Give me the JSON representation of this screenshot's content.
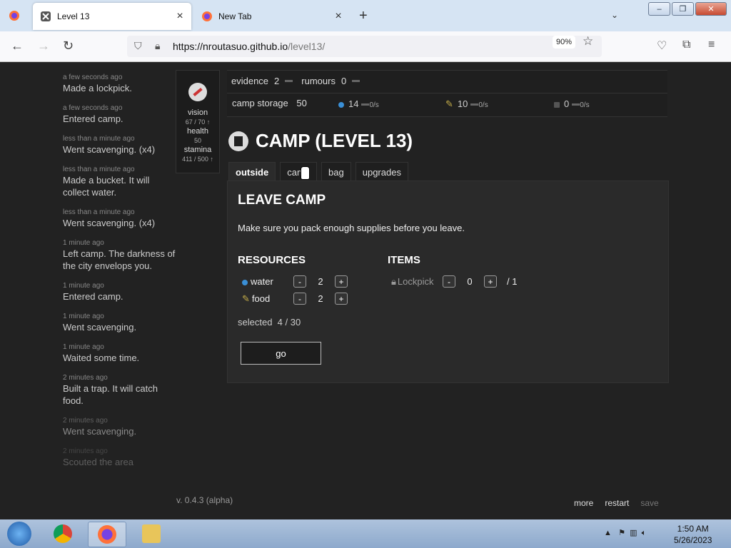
{
  "browser": {
    "tabs": [
      {
        "title": "Level 13",
        "active": true
      },
      {
        "title": "New Tab",
        "active": false
      }
    ],
    "url_host": "https://nroutasuo.github.io",
    "url_path": "/level13/",
    "zoom": "90%"
  },
  "log": [
    {
      "time": "a few seconds ago",
      "msg": "Made a lockpick."
    },
    {
      "time": "a few seconds ago",
      "msg": "Entered camp."
    },
    {
      "time": "less than a minute ago",
      "msg": "Went scavenging. (x4)"
    },
    {
      "time": "less than a minute ago",
      "msg": "Made a bucket. It will collect water."
    },
    {
      "time": "less than a minute ago",
      "msg": "Went scavenging. (x4)"
    },
    {
      "time": "1 minute ago",
      "msg": "Left camp. The darkness of the city envelops you."
    },
    {
      "time": "1 minute ago",
      "msg": "Entered camp."
    },
    {
      "time": "1 minute ago",
      "msg": "Went scavenging."
    },
    {
      "time": "1 minute ago",
      "msg": "Waited some time."
    },
    {
      "time": "2 minutes ago",
      "msg": "Built a trap. It will catch food."
    },
    {
      "time": "2 minutes ago",
      "msg": "Went scavenging."
    },
    {
      "time": "2 minutes ago",
      "msg": "Scouted the area"
    }
  ],
  "status": {
    "vision_label": "vision",
    "vision_value": "67 / 70 ↑",
    "health_label": "health",
    "health_value": "50",
    "stamina_label": "stamina",
    "stamina_value": "411 / 500 ↑"
  },
  "resources_bar": {
    "evidence_label": "evidence",
    "evidence_value": "2",
    "rumours_label": "rumours",
    "rumours_value": "0",
    "storage_label": "camp storage",
    "storage_value": "50",
    "items": [
      {
        "icon": "water-drop-icon",
        "value": "14",
        "rate": "0/s",
        "color": "#3a8fd6"
      },
      {
        "icon": "food-icon",
        "value": "10",
        "rate": "0/s",
        "color": "#c8b04a"
      },
      {
        "icon": "metal-icon",
        "value": "0",
        "rate": "0/s",
        "color": "#555555"
      }
    ]
  },
  "camp": {
    "title": "CAMP (LEVEL 13)",
    "tabs": [
      "outside",
      "camp",
      "bag",
      "upgrades"
    ],
    "selected_tab": "outside"
  },
  "leave": {
    "title": "LEAVE CAMP",
    "description": "Make sure you pack enough supplies before you leave.",
    "resources_heading": "RESOURCES",
    "items_heading": "ITEMS",
    "water_label": "water",
    "water_count": "2",
    "food_label": "food",
    "food_count": "2",
    "lockpick_label": "Lockpick",
    "lockpick_count": "0",
    "lockpick_max": "/ 1",
    "selected_label": "selected",
    "selected_value": "4 / 30",
    "go_label": "go",
    "minus": "-",
    "plus": "+"
  },
  "footer": {
    "version": "v. 0.4.3 (alpha)",
    "more": "more",
    "restart": "restart",
    "save": "save"
  },
  "taskbar": {
    "time": "1:50 AM",
    "date": "5/26/2023"
  }
}
